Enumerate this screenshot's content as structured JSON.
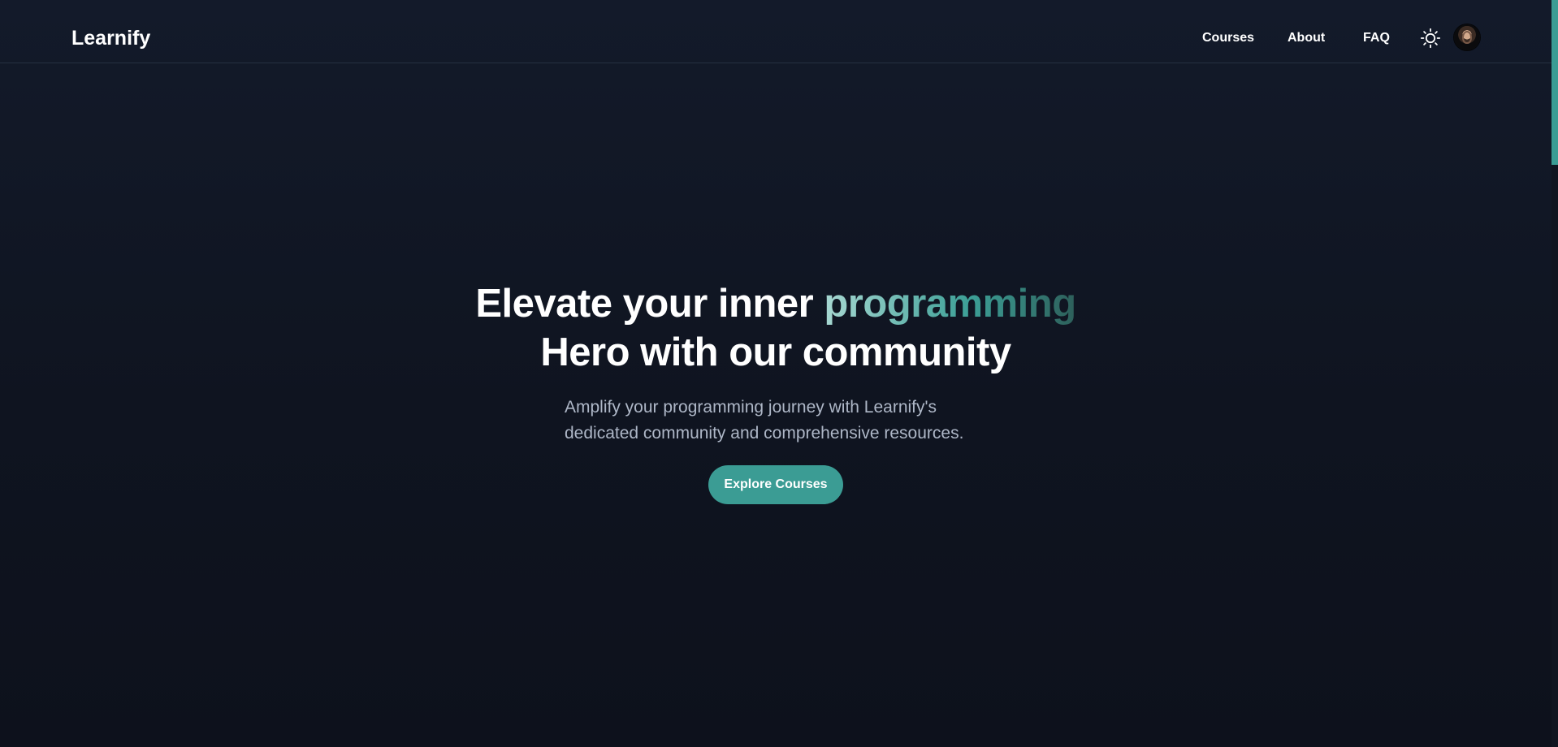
{
  "brand": {
    "name": "Learnify"
  },
  "nav": {
    "items": [
      {
        "label": "Courses"
      },
      {
        "label": "About"
      },
      {
        "label": "FAQ"
      }
    ],
    "theme_icon": "sun-icon",
    "avatar_icon": "user-avatar"
  },
  "hero": {
    "title_prefix": "Elevate your inner ",
    "title_highlight": "programming",
    "title_suffix": "Hero with our community",
    "subtitle_line_1": "Amplify your programming journey with Learnify's",
    "subtitle_line_2": "dedicated community and comprehensive resources.",
    "cta_label": "Explore Courses"
  },
  "colors": {
    "background": "#111827",
    "accent": "#3b9c94",
    "text": "#ffffff",
    "muted_text": "#aeb7c7"
  }
}
